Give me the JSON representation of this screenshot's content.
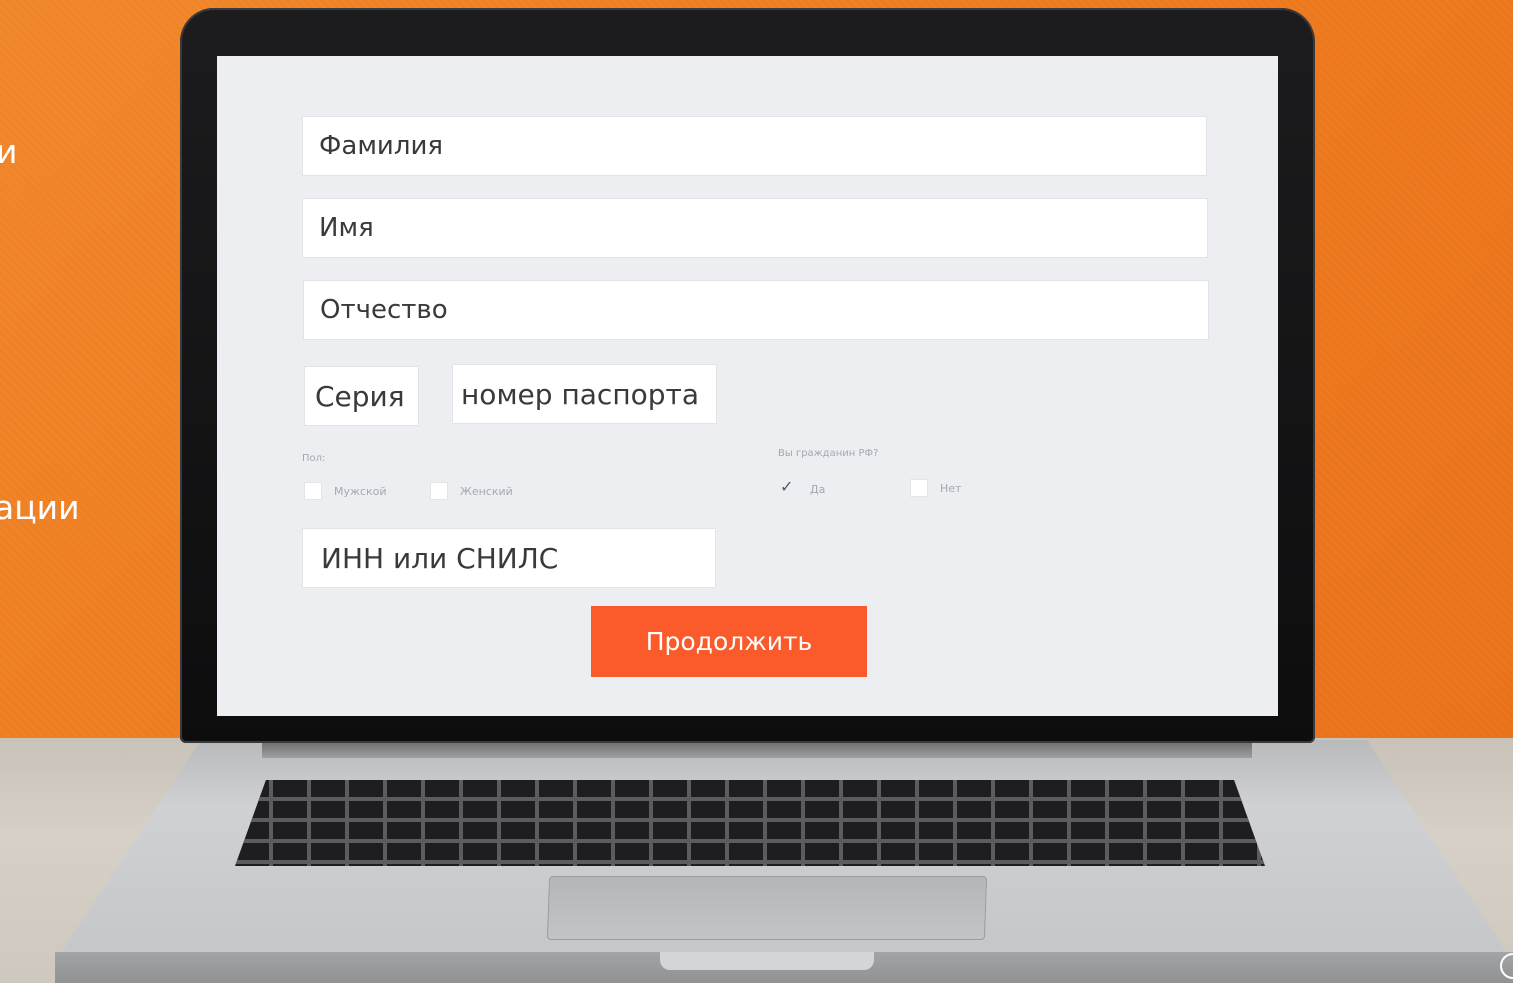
{
  "left_text": {
    "line1": "и",
    "line2": "ации"
  },
  "form": {
    "surname_placeholder": "Фамилия",
    "name_placeholder": "Имя",
    "patronymic_placeholder": "Отчество",
    "series_placeholder": "Серия",
    "passport_placeholder": "номер паспорта",
    "gender_label": "Пол:",
    "gender_options": [
      "Мужской",
      "Женский"
    ],
    "citizen_label": "Вы гражданин РФ?",
    "citizen_options": [
      "Да",
      "Нет"
    ],
    "citizen_selected": "Да",
    "inn_placeholder": "ИНН или СНИЛС",
    "submit_label": "Продолжить"
  },
  "colors": {
    "background": "#ee7a1e",
    "submit_button": "#fb5b2a",
    "screen": "#eceef1"
  },
  "icons": {
    "checkbox_checked": "check-icon"
  }
}
